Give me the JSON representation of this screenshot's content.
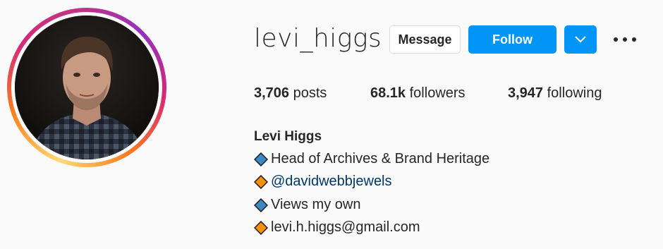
{
  "profile": {
    "username": "levi_higgs",
    "avatar_alt": "profile-photo"
  },
  "actions": {
    "message_label": "Message",
    "follow_label": "Follow",
    "dropdown_icon": "chevron-down-icon",
    "more_icon": "more-options-icon"
  },
  "stats": {
    "posts_count": "3,706",
    "posts_label": "posts",
    "followers_count": "68.1k",
    "followers_label": "followers",
    "following_count": "3,947",
    "following_label": "following"
  },
  "bio": {
    "name": "Levi Higgs",
    "lines": [
      {
        "icon": "blue-diamond-icon",
        "text": "Head of Archives & Brand Heritage"
      },
      {
        "icon": "orange-diamond-icon",
        "text": "@davidwebbjewels"
      },
      {
        "icon": "blue-diamond-icon",
        "text": "Views my own"
      },
      {
        "icon": "orange-diamond-icon",
        "text": "levi.h.higgs@gmail.com"
      }
    ]
  },
  "colors": {
    "follow_blue": "#0095f6",
    "link": "#00376b",
    "blue_diamond": "#3b88c3",
    "orange_diamond": "#f4900c"
  }
}
